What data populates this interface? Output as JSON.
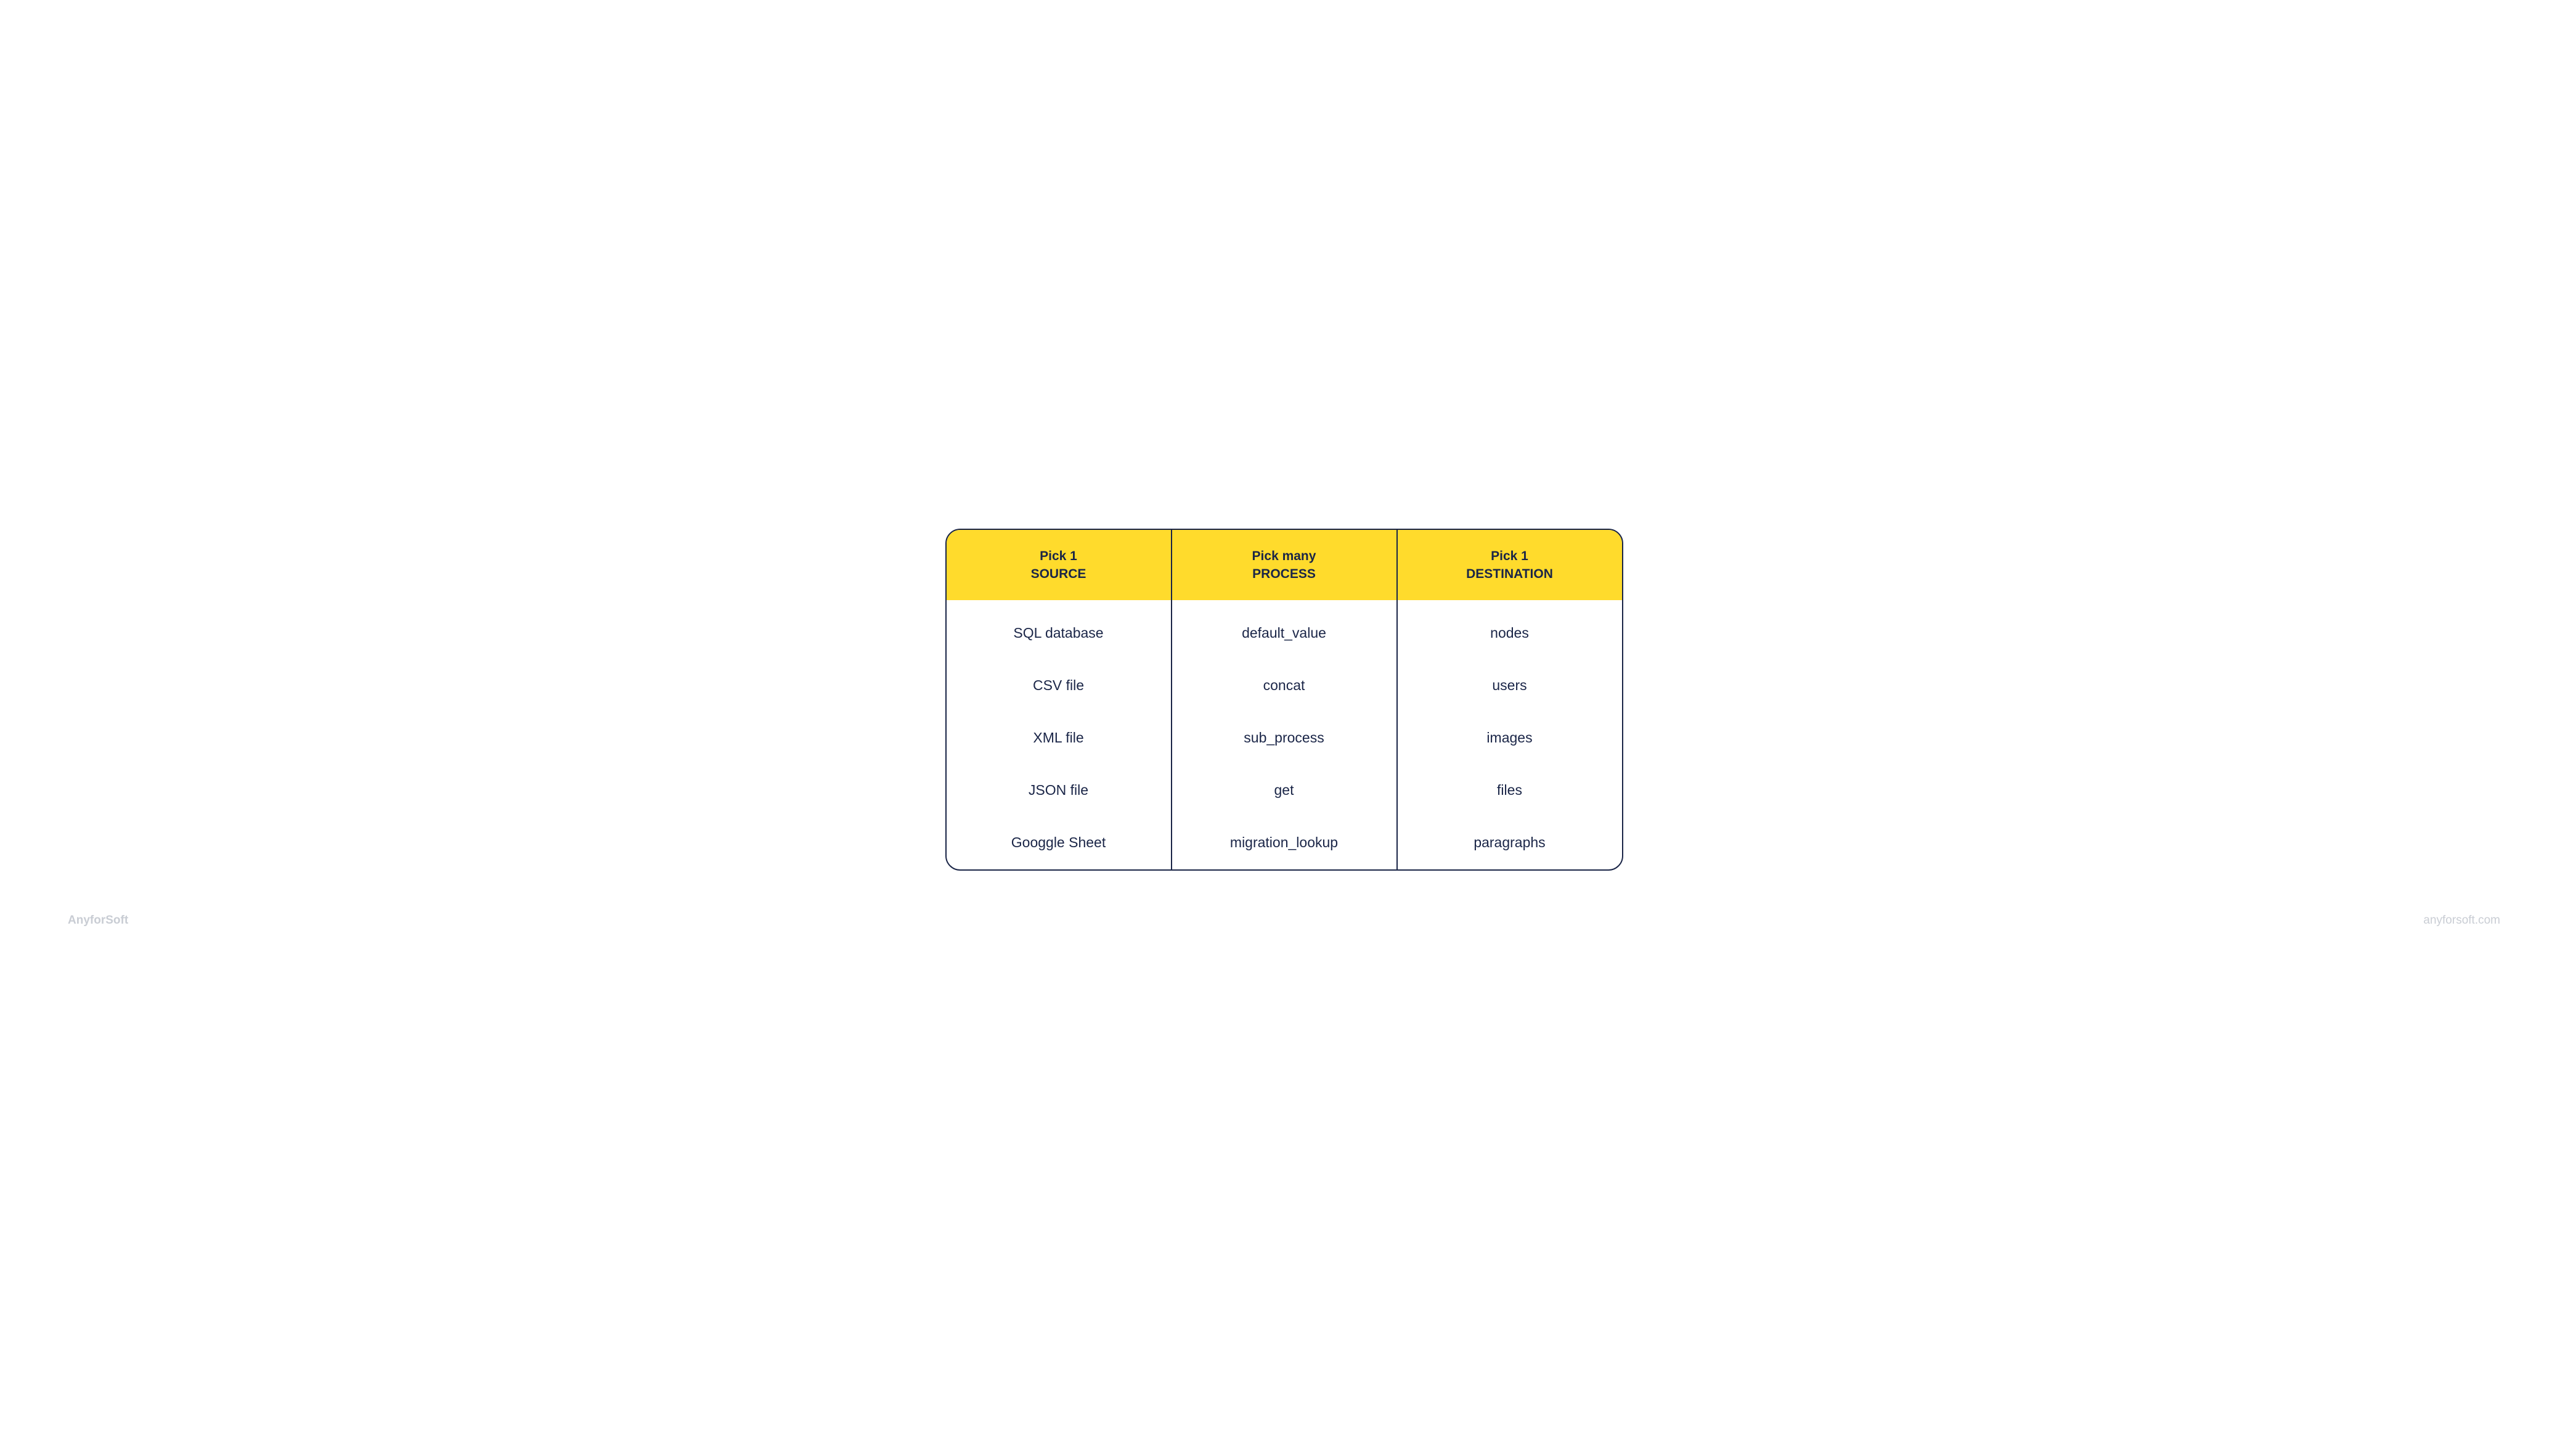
{
  "table": {
    "columns": [
      {
        "header_line1": "Pick 1",
        "header_line2": "SOURCE",
        "items": [
          "SQL database",
          "CSV file",
          "XML file",
          "JSON file",
          "Googgle Sheet"
        ]
      },
      {
        "header_line1": "Pick many",
        "header_line2": "PROCESS",
        "items": [
          "default_value",
          "concat",
          "sub_process",
          "get",
          "migration_lookup"
        ]
      },
      {
        "header_line1": "Pick 1",
        "header_line2": "DESTINATION",
        "items": [
          "nodes",
          "users",
          "images",
          "files",
          "paragraphs"
        ]
      }
    ]
  },
  "footer": {
    "brand": "AnyforSoft",
    "url": "anyforsoft.com"
  }
}
